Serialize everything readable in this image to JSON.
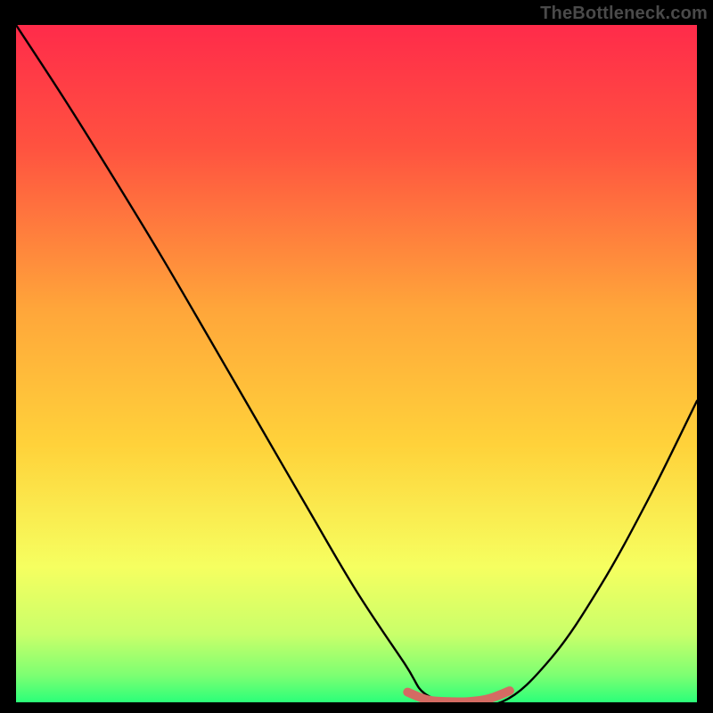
{
  "watermark": "TheBottleneck.com",
  "chart_data": {
    "type": "line",
    "title": "",
    "xlabel": "",
    "ylabel": "",
    "xlim": [
      0,
      100
    ],
    "ylim": [
      0,
      100
    ],
    "background_gradient": {
      "top": "#ff2b4a",
      "mid": "#ffd23a",
      "bottom": "#2bff79"
    },
    "series": [
      {
        "name": "curve",
        "stroke": "#000000",
        "x": [
          0.0,
          7.14,
          14.29,
          21.43,
          28.57,
          35.71,
          42.86,
          50.0,
          57.14,
          60.0,
          64.29,
          71.43,
          78.57,
          85.71,
          92.86,
          100.0
        ],
        "values": [
          100.0,
          89.0,
          77.5,
          65.7,
          53.4,
          41.0,
          28.6,
          16.4,
          5.6,
          1.3,
          0.2,
          0.1,
          6.5,
          17.0,
          30.0,
          44.5
        ]
      }
    ],
    "highlight_band": {
      "name": "optimal-zone",
      "color": "#d46b63",
      "x": [
        57.5,
        72.5
      ],
      "values": [
        1.5,
        0.35,
        0.1,
        0.1,
        0.55,
        1.7
      ]
    }
  }
}
